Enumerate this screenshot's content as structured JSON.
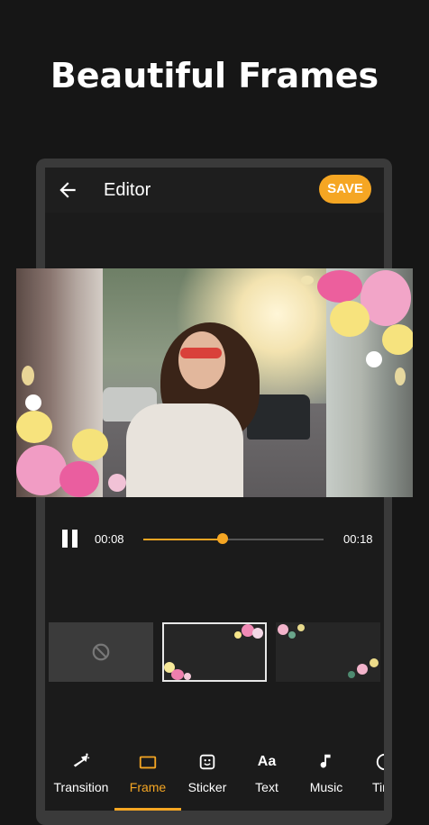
{
  "headline": "Beautiful Frames",
  "appbar": {
    "title": "Editor",
    "save_label": "SAVE"
  },
  "player": {
    "current_time": "00:08",
    "total_time": "00:18",
    "progress": 0.44
  },
  "frames": {
    "items": [
      {
        "name": "none",
        "icon": "block-icon"
      },
      {
        "name": "pink-flowers",
        "selected": true
      },
      {
        "name": "mixed-flowers"
      }
    ]
  },
  "nav": {
    "items": [
      {
        "label": "Transition",
        "icon": "transition-icon"
      },
      {
        "label": "Frame",
        "icon": "frame-icon",
        "active": true
      },
      {
        "label": "Sticker",
        "icon": "sticker-icon"
      },
      {
        "label": "Text",
        "icon": "text-icon",
        "glyph": "Aa"
      },
      {
        "label": "Music",
        "icon": "music-icon"
      },
      {
        "label": "Tir",
        "icon": "timer-icon"
      }
    ]
  },
  "colors": {
    "accent": "#f5a623",
    "background": "#161616"
  }
}
